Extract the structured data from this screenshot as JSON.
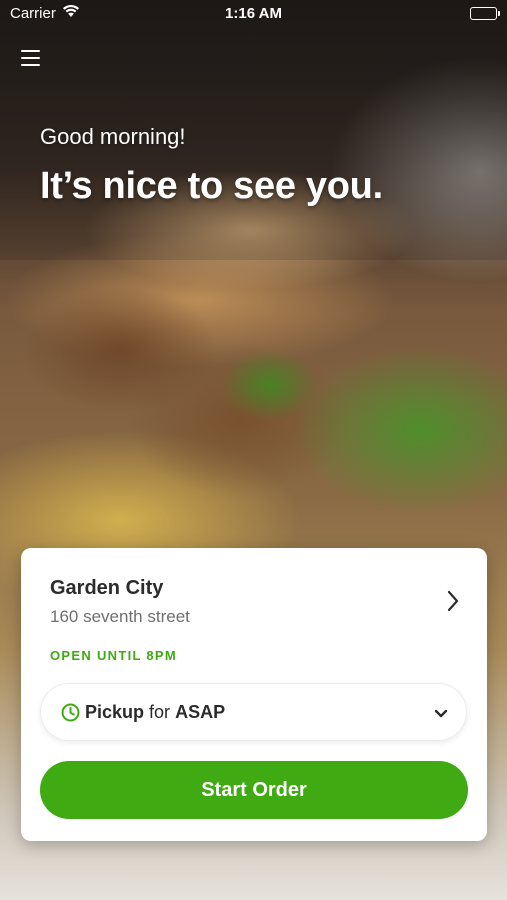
{
  "status_bar": {
    "carrier": "Carrier",
    "time": "1:16 AM"
  },
  "greeting": "Good morning!",
  "headline": "It’s nice to see you.",
  "store": {
    "name": "Garden City",
    "address": "160 seventh street",
    "hours": "OPEN UNTIL 8PM"
  },
  "order_mode": {
    "mode": "Pickup",
    "connector": "for",
    "time": "ASAP"
  },
  "start_order_label": "Start Order",
  "colors": {
    "accent": "#3faa12",
    "text": "#2b2b2b",
    "muted": "#6f6f6f"
  },
  "icons": [
    "wifi-icon",
    "battery-icon",
    "menu-icon",
    "chevron-right-icon",
    "clock-icon",
    "chevron-down-icon"
  ]
}
